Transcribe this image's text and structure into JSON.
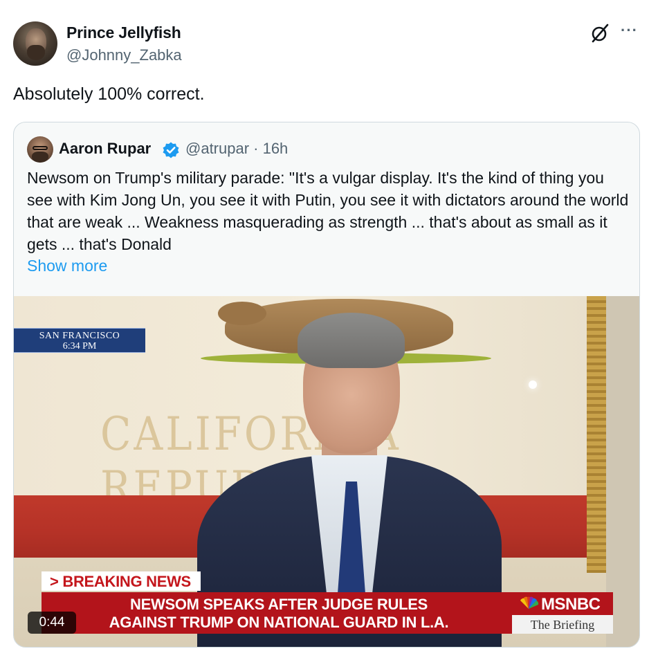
{
  "author": {
    "name": "Prince Jellyfish",
    "handle": "@Johnny_Zabka"
  },
  "icons": {
    "grok": "grok-icon",
    "more": "more-dots-icon",
    "verified": "verified-badge-icon"
  },
  "tweet": {
    "text": "Absolutely 100% correct."
  },
  "more_label": "···",
  "quoted": {
    "name": "Aaron Rupar",
    "handle_time": "@atrupar · 16h",
    "text": "Newsom on Trump's military parade: \"It's a vulgar display. It's the kind of thing you see with Kim Jong Un, you see it with Putin, you see it with dictators around the world that are weak ... Weakness masquerading as strength ... that's about as small as it gets ... that's Donald",
    "show_more": "Show more",
    "video": {
      "duration": "0:44",
      "location": "SAN FRANCISCO",
      "local_time": "6:34 PM",
      "flag_text": "CALIFORNIA REPUBLIC",
      "breaking_label": "> BREAKING NEWS",
      "headline_line1": "NEWSOM SPEAKS AFTER JUDGE RULES",
      "headline_line2": "AGAINST TRUMP ON NATIONAL GUARD IN L.A.",
      "network": "MSNBC",
      "show": "The Briefing"
    }
  },
  "colors": {
    "link": "#1d9bf0",
    "secondary_text": "#536471",
    "verified": "#1d9bf0",
    "banner_red": "#b3141b"
  }
}
